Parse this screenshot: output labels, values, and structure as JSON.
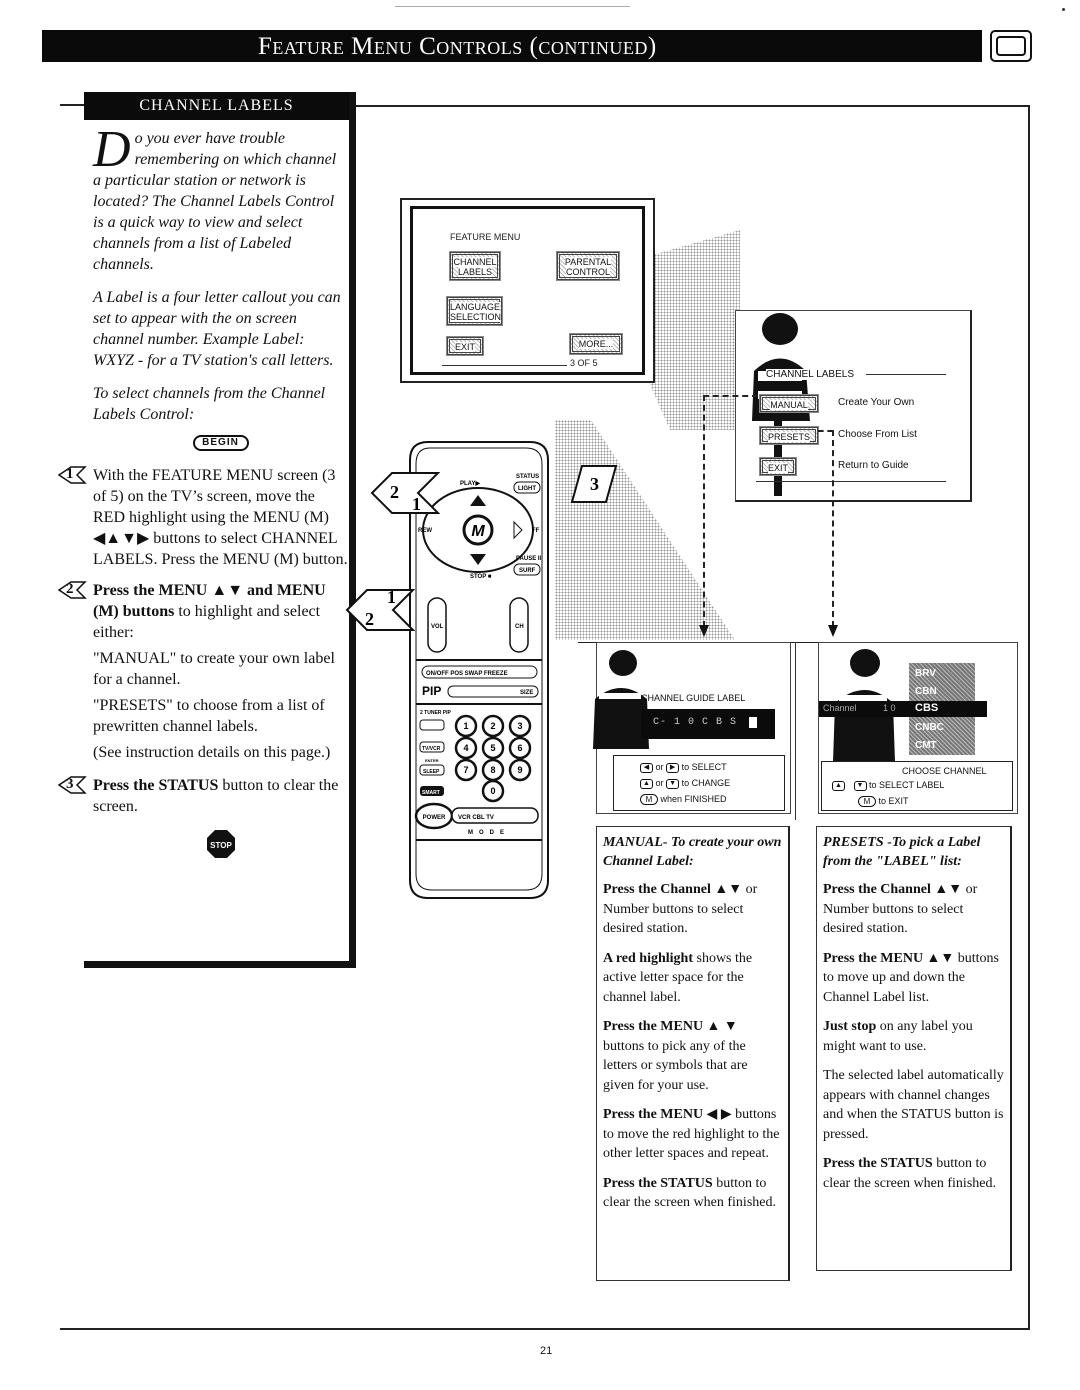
{
  "page": {
    "title": "Feature Menu Controls (continued)",
    "page_number": "21",
    "tv_icon": "tv-icon"
  },
  "sidebar": {
    "header": "CHANNEL LABELS",
    "intro_dropcap": "D",
    "intro_rest": "o you ever have trouble remembering on which channel a particular station or network is located? The Channel Labels Control is a quick way to view and select channels from a list of Labeled channels.",
    "label_explanation": "A Label is a four letter callout you can set to appear with the on screen channel number. Example Label: WXYZ - for a TV station's call letters.",
    "select_intro": "To select channels from the Channel Labels Control:",
    "begin_label": "BEGIN",
    "steps": [
      {
        "number": "1",
        "text": "With the FEATURE MENU screen (3 of 5) on the TV’s screen, move the RED highlight using the MENU (M) ◀▲▼▶ buttons to select CHANNEL LABELS. Press the MENU (M) button."
      },
      {
        "number": "2",
        "bold": "Press the MENU ▲▼ and MENU (M) buttons",
        "text": " to highlight and select either:",
        "options": [
          "\"MANUAL\" to create your own label for a channel.",
          "\"PRESETS\" to choose from a list of prewritten channel labels.",
          "(See instruction details on this page.)"
        ]
      },
      {
        "number": "3",
        "bold": "Press the STATUS",
        "text": " button to clear the screen."
      }
    ],
    "stop_label": "STOP"
  },
  "feature_menu_screen": {
    "caption": "FEATURE MENU",
    "buttons": [
      "CHANNEL LABELS",
      "PARENTAL CONTROL",
      "LANGUAGE SELECTION",
      "EXIT",
      "MORE..."
    ],
    "page_indicator": "3 OF 5",
    "highlighted": "CHANNEL LABELS"
  },
  "channel_labels_screen": {
    "caption": "CHANNEL LABELS",
    "items": [
      {
        "button": "MANUAL",
        "description": "Create Your Own"
      },
      {
        "button": "PRESETS",
        "description": "Choose From List"
      },
      {
        "button": "EXIT",
        "description": "Return to Guide"
      }
    ]
  },
  "manual_screen": {
    "caption": "CHANNEL GUIDE LABEL",
    "readout": "C- 1 0  C B S",
    "hints": [
      {
        "keys": [
          "◀",
          "▶"
        ],
        "joiner": "or",
        "action": "to SELECT"
      },
      {
        "keys": [
          "▲",
          "▼"
        ],
        "joiner": "or",
        "action": "to CHANGE"
      },
      {
        "keys": [
          "M"
        ],
        "joiner": "",
        "action": "when FINISHED"
      }
    ]
  },
  "presets_screen": {
    "channel_label": "Channel",
    "channel_number": "1 0",
    "list": [
      "BRV",
      "CBN",
      "CBS",
      "CNBC",
      "CMT"
    ],
    "selected": "CBS",
    "hints": {
      "title": "CHOOSE CHANNEL",
      "select": "to SELECT LABEL",
      "exit": "to EXIT",
      "m_key": "M"
    }
  },
  "remote": {
    "labels": [
      "PLAY▶",
      "STATUS",
      "LIGHT",
      "REW",
      "FF",
      "PAUSE II",
      "SURF",
      "STOP ■",
      "VOL",
      "CH",
      "ON/OFF",
      "POS",
      "SWAP",
      "FREEZE",
      "PIP",
      "SIZE",
      "2 TUNER PIP",
      "TV/VCR",
      "ENTER",
      "SLEEP",
      "SMART",
      "POWER",
      "VCR",
      "CBL",
      "TV",
      "M O D E"
    ],
    "number_keys": [
      "1",
      "2",
      "3",
      "4",
      "5",
      "6",
      "7",
      "8",
      "9",
      "0"
    ],
    "menu_key": "M",
    "step_callouts": [
      "2",
      "1",
      "3",
      "1",
      "2"
    ]
  },
  "manual_instructions": {
    "heading": "MANUAL- To create your own Channel Label:",
    "items": [
      {
        "bold": "Press the Channel ▲▼",
        "text": " or Number buttons to select desired station."
      },
      {
        "bold": "A red highlight",
        "text": " shows the active letter space for the channel label."
      },
      {
        "bold": "Press the MENU ▲ ▼",
        "text": " buttons to pick any of the letters or symbols that are given for your use."
      },
      {
        "bold": "Press the MENU ◀ ▶",
        "text": " buttons to move the red highlight to the other letter spaces and repeat."
      },
      {
        "bold": "Press the STATUS",
        "text": " button to clear the screen when finished."
      }
    ]
  },
  "presets_instructions": {
    "heading": "PRESETS -To pick a Label from the \"LABEL\" list:",
    "items": [
      {
        "bold": "Press the Channel ▲▼",
        "text": " or Number buttons to select desired station."
      },
      {
        "bold": "Press the MENU ▲▼",
        "text": " buttons to move up and down the Channel Label list."
      },
      {
        "bold": "Just stop",
        "text": " on any label you might want to use."
      },
      {
        "bold": "",
        "text": "The selected label automatically appears with channel changes and when the STATUS button is pressed."
      },
      {
        "bold": "Press the STATUS",
        "text": " button to clear the screen when finished."
      }
    ]
  }
}
